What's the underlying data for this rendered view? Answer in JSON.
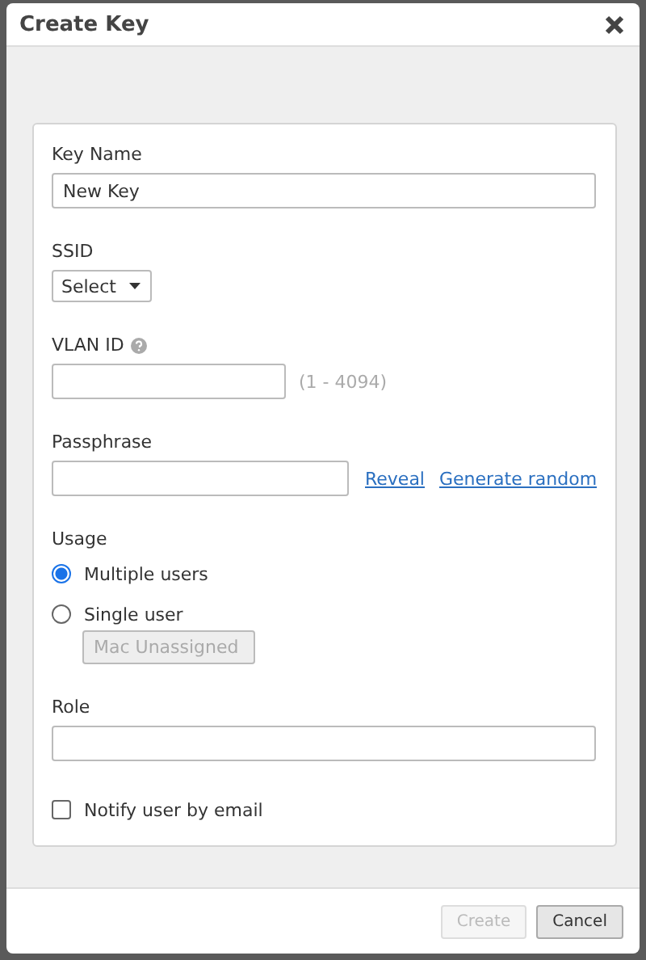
{
  "dialog": {
    "title": "Create Key"
  },
  "form": [
    {
      "kind": "text",
      "label": "Key Name",
      "value": "New Key",
      "wide": true
    },
    {
      "kind": "select",
      "label": "SSID",
      "value": "Select"
    },
    {
      "kind": "text",
      "label": "VLAN ID",
      "help": true,
      "hint": "(1 - 4094)"
    },
    {
      "kind": "passphrase",
      "label": "Passphrase",
      "links": [
        "Reveal",
        "Generate random"
      ]
    },
    {
      "kind": "radios",
      "label": "Usage",
      "options": [
        {
          "label": "Multiple users",
          "selected": true
        },
        {
          "label": "Single user",
          "selected": false,
          "sub": {
            "value": "Mac Unassigned",
            "disabled": true
          }
        }
      ]
    },
    {
      "kind": "text",
      "label": "Role",
      "wide": true
    },
    {
      "kind": "checkbox",
      "label": "Notify user by email",
      "checked": false
    }
  ],
  "buttons": [
    {
      "label": "Create",
      "disabled": true
    },
    {
      "label": "Cancel",
      "disabled": false
    }
  ]
}
